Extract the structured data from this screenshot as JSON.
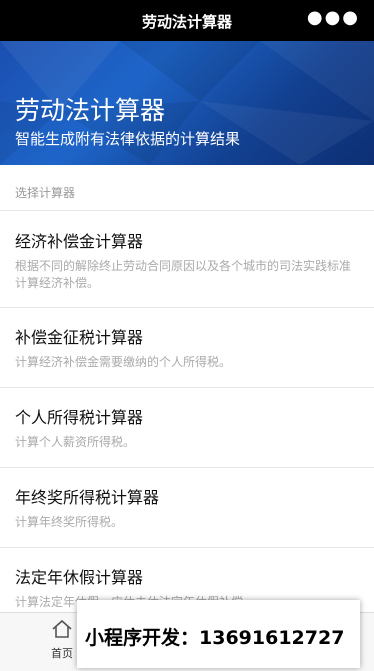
{
  "nav": {
    "title": "劳动法计算器",
    "menu_icon": "more-dots-icon"
  },
  "hero": {
    "title": "劳动法计算器",
    "subtitle": "智能生成附有法律依据的计算结果"
  },
  "section_label": "选择计算器",
  "calculators": [
    {
      "name": "经济补偿金计算器",
      "desc": "根据不同的解除终止劳动合同原因以及各个城市的司法实践标准计算经济补偿。"
    },
    {
      "name": "补偿金征税计算器",
      "desc": "计算经济补偿金需要缴纳的个人所得税。"
    },
    {
      "name": "个人所得税计算器",
      "desc": "计算个人薪资所得税。"
    },
    {
      "name": "年终奖所得税计算器",
      "desc": "计算年终奖所得税。"
    },
    {
      "name": "法定年休假计算器",
      "desc": "计算法定年休假、应休未休法定年休假补偿"
    }
  ],
  "tabbar": {
    "home_label": "首页",
    "home_icon": "home-icon"
  },
  "ad_banner": {
    "text": "小程序开发：13691612727"
  }
}
